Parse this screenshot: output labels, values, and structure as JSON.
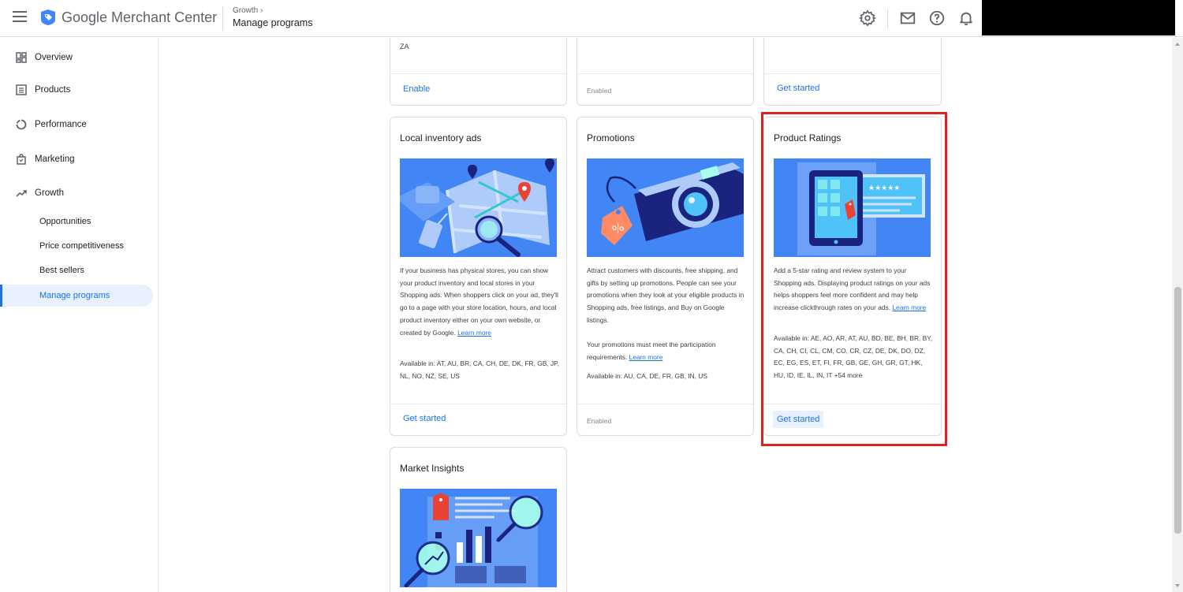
{
  "header": {
    "app_title": "Google Merchant Center",
    "breadcrumb_parent": "Growth",
    "breadcrumb_current": "Manage programs"
  },
  "sidebar": {
    "items": [
      {
        "label": "Overview",
        "icon": "overview-grid-icon"
      },
      {
        "label": "Products",
        "icon": "products-list-icon"
      },
      {
        "label": "Performance",
        "icon": "performance-donut-icon"
      },
      {
        "label": "Marketing",
        "icon": "marketing-bag-icon"
      },
      {
        "label": "Growth",
        "icon": "growth-trend-icon"
      }
    ],
    "sub_items": [
      {
        "label": "Opportunities"
      },
      {
        "label": "Price competitiveness"
      },
      {
        "label": "Best sellers"
      },
      {
        "label": "Manage programs",
        "active": true
      }
    ]
  },
  "cards_top": [
    {
      "text": "ZA",
      "footer": "Enable"
    },
    {
      "text": "",
      "footer": "Enabled"
    },
    {
      "text": "",
      "footer": "Get started"
    }
  ],
  "cards": {
    "local_inventory": {
      "title": "Local inventory ads",
      "description": "If your business has physical stores, you can show your product inventory and local stores in your Shopping ads. When shoppers click on your ad, they'll go to a page with your store location, hours, and local product inventory either on your own website, or created by Google.",
      "learn_more": "Learn more",
      "available": "Available in: AT, AU, BR, CA, CH, DE, DK, FR, GB, JP, NL, NO, NZ, SE, US",
      "footer": "Get started"
    },
    "promotions": {
      "title": "Promotions",
      "description": "Attract customers with discounts, free shipping, and gifts by setting up promotions. People can see your promotions when they look at your eligible products in Shopping ads, free listings, and Buy on Google listings.",
      "description2": "Your promotions must meet the participation requirements.",
      "learn_more": "Learn more",
      "available": "Available in: AU, CA, DE, FR, GB, IN, US",
      "footer": "Enabled"
    },
    "product_ratings": {
      "title": "Product Ratings",
      "description": "Add a 5-star rating and review system to your Shopping ads. Displaying product ratings on your ads helps shoppers feel more confident and may help increase clickthrough rates on your ads.",
      "learn_more": "Learn more",
      "available": "Available in: AE, AO, AR, AT, AU, BD, BE, BH, BR, BY, CA, CH, CI, CL, CM, CO, CR, CZ, DE, DK, DO, DZ, EC, EG, ES, ET, FI, FR, GB, GE, GH, GR, GT, HK, HU, ID, IE, IL, IN, IT +54 more",
      "footer": "Get started"
    },
    "market_insights": {
      "title": "Market Insights"
    }
  },
  "colors": {
    "accent": "#1a73e8",
    "highlight": "#e0201f",
    "illustration_blue": "#4285f4"
  }
}
